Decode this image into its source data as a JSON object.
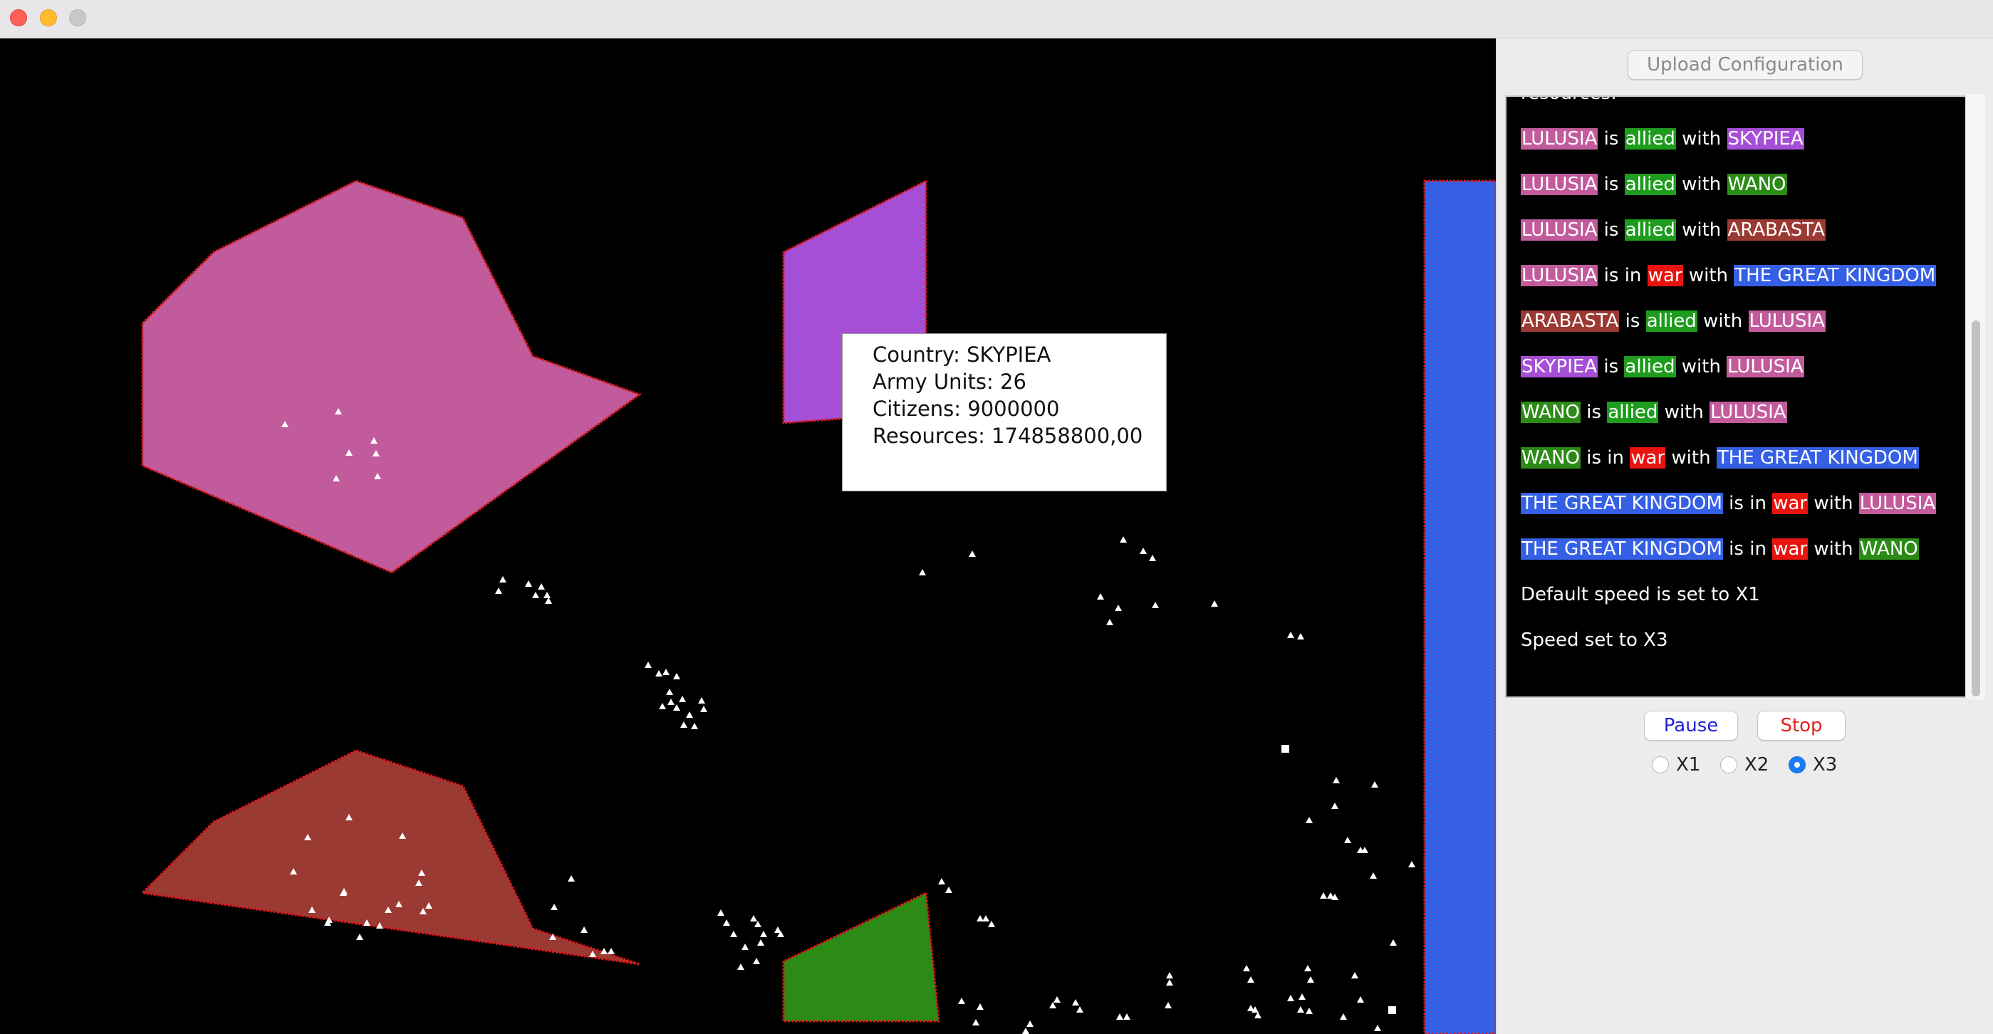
{
  "window": {
    "controls": [
      "close-icon",
      "minimize-icon",
      "zoom-icon"
    ]
  },
  "colors": {
    "lulusia": "#c25b9b",
    "skypiea": "#a54ed6",
    "wano": "#2c8a17",
    "arabasta": "#9a3a33",
    "kingdom": "#3560e6",
    "allied": "#1e9c1e",
    "war": "#e8140f",
    "canvas_background": "#000000",
    "border": "#e0141a"
  },
  "tooltip": {
    "country": "Country: SKYPIEA",
    "army": "Army Units: 26",
    "citizens": "Citizens: 9000000",
    "resources": "Resources: 174858800,00"
  },
  "panel": {
    "upload_label": "Upload Configuration",
    "log_partial": "resources:",
    "log": [
      {
        "parts": [
          {
            "t": "LULUSIA",
            "c": "lulusia"
          },
          {
            "t": " is "
          },
          {
            "t": "allied",
            "c": "allied"
          },
          {
            "t": " with "
          },
          {
            "t": "SKYPIEA",
            "c": "skypiea"
          }
        ]
      },
      {
        "parts": [
          {
            "t": "LULUSIA",
            "c": "lulusia"
          },
          {
            "t": " is "
          },
          {
            "t": "allied",
            "c": "allied"
          },
          {
            "t": " with "
          },
          {
            "t": "WANO",
            "c": "wano"
          }
        ]
      },
      {
        "parts": [
          {
            "t": "LULUSIA",
            "c": "lulusia"
          },
          {
            "t": " is "
          },
          {
            "t": "allied",
            "c": "allied"
          },
          {
            "t": " with "
          },
          {
            "t": "ARABASTA",
            "c": "arabasta"
          }
        ]
      },
      {
        "parts": [
          {
            "t": "LULUSIA",
            "c": "lulusia"
          },
          {
            "t": " is in "
          },
          {
            "t": "war",
            "c": "war"
          },
          {
            "t": " with "
          },
          {
            "t": "THE GREAT KINGDOM",
            "c": "kingdom"
          }
        ]
      },
      {
        "parts": [
          {
            "t": "ARABASTA",
            "c": "arabasta"
          },
          {
            "t": " is "
          },
          {
            "t": "allied",
            "c": "allied"
          },
          {
            "t": " with "
          },
          {
            "t": "LULUSIA",
            "c": "lulusia"
          }
        ]
      },
      {
        "parts": [
          {
            "t": "SKYPIEA",
            "c": "skypiea"
          },
          {
            "t": " is "
          },
          {
            "t": "allied",
            "c": "allied"
          },
          {
            "t": " with "
          },
          {
            "t": "LULUSIA",
            "c": "lulusia"
          }
        ]
      },
      {
        "parts": [
          {
            "t": "WANO",
            "c": "wano"
          },
          {
            "t": " is "
          },
          {
            "t": "allied",
            "c": "allied"
          },
          {
            "t": " with "
          },
          {
            "t": "LULUSIA",
            "c": "lulusia"
          }
        ]
      },
      {
        "parts": [
          {
            "t": "WANO",
            "c": "wano"
          },
          {
            "t": " is in "
          },
          {
            "t": "war",
            "c": "war"
          },
          {
            "t": " with "
          },
          {
            "t": "THE GREAT KINGDOM",
            "c": "kingdom"
          }
        ]
      },
      {
        "parts": [
          {
            "t": "THE GREAT KINGDOM",
            "c": "kingdom"
          },
          {
            "t": " is in "
          },
          {
            "t": "war",
            "c": "war"
          },
          {
            "t": " with "
          },
          {
            "t": "LULUSIA",
            "c": "lulusia"
          }
        ]
      },
      {
        "parts": [
          {
            "t": "THE GREAT KINGDOM",
            "c": "kingdom"
          },
          {
            "t": " is in "
          },
          {
            "t": "war",
            "c": "war"
          },
          {
            "t": " with "
          },
          {
            "t": "WANO",
            "c": "wano"
          }
        ]
      },
      {
        "parts": [
          {
            "t": "Default speed is set to X1"
          }
        ]
      },
      {
        "parts": [
          {
            "t": "Speed set to X3"
          }
        ]
      }
    ],
    "pause_label": "Pause",
    "stop_label": "Stop",
    "speed_options": [
      {
        "label": "X1",
        "selected": false
      },
      {
        "label": "X2",
        "selected": false
      },
      {
        "label": "X3",
        "selected": true
      }
    ]
  }
}
